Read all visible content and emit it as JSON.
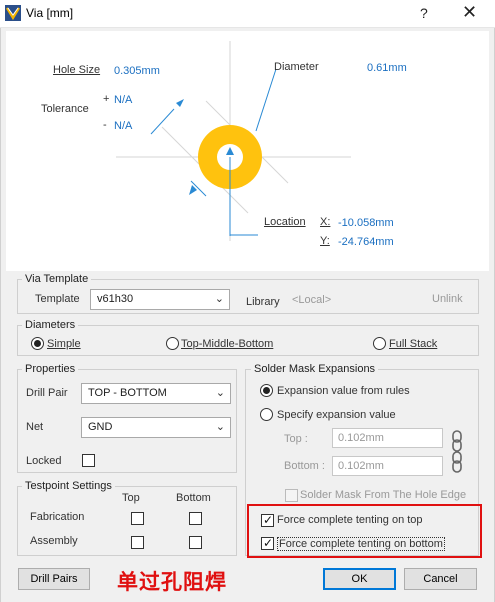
{
  "window": {
    "title": "Via [mm]",
    "help": "?",
    "close": "✕"
  },
  "preview": {
    "hole_size_label": "Hole Size",
    "hole_size_value": "0.305mm",
    "tolerance_label": "Tolerance",
    "tol_plus_sign": "+",
    "tol_plus_value": "N/A",
    "tol_minus_sign": "-",
    "tol_minus_value": "N/A",
    "diameter_label": "Diameter",
    "diameter_value": "0.61mm",
    "location_label": "Location",
    "x_label": "X:",
    "x_value": "-10.058mm",
    "y_label": "Y:",
    "y_value": "-24.764mm",
    "via_ring_color": "#ffc20e"
  },
  "via_template": {
    "group_title": "Via Template",
    "template_label": "Template",
    "template_value": "v61h30",
    "library_label": "Library",
    "library_value": "<Local>",
    "unlink_label": "Unlink"
  },
  "diameters": {
    "group_title": "Diameters",
    "options": [
      {
        "label": "Simple",
        "selected": true
      },
      {
        "label": "Top-Middle-Bottom",
        "selected": false
      },
      {
        "label": "Full Stack",
        "selected": false
      }
    ]
  },
  "properties": {
    "group_title": "Properties",
    "drill_pair_label": "Drill Pair",
    "drill_pair_value": "TOP - BOTTOM",
    "net_label": "Net",
    "net_value": "GND",
    "locked_label": "Locked",
    "locked_checked": false
  },
  "testpoint": {
    "group_title": "Testpoint Settings",
    "col_top": "Top",
    "col_bottom": "Bottom",
    "rows": [
      {
        "label": "Fabrication",
        "top": false,
        "bottom": false
      },
      {
        "label": "Assembly",
        "top": false,
        "bottom": false
      }
    ]
  },
  "solder_mask": {
    "group_title": "Solder Mask Expansions",
    "opt_rules": "Expansion value from rules",
    "opt_specify": "Specify expansion value",
    "top_label": "Top :",
    "top_value": "0.102mm",
    "bottom_label": "Bottom :",
    "bottom_value": "0.102mm",
    "from_hole_edge": "Solder Mask From The Hole Edge",
    "tent_top": "Force complete tenting on top",
    "tent_top_checked": true,
    "tent_bottom": "Force complete tenting on bottom",
    "tent_bottom_checked": true
  },
  "annotation": {
    "text": "单过孔阻焊",
    "color": "#e01010"
  },
  "footer": {
    "drill_pairs": "Drill Pairs",
    "ok": "OK",
    "cancel": "Cancel"
  }
}
